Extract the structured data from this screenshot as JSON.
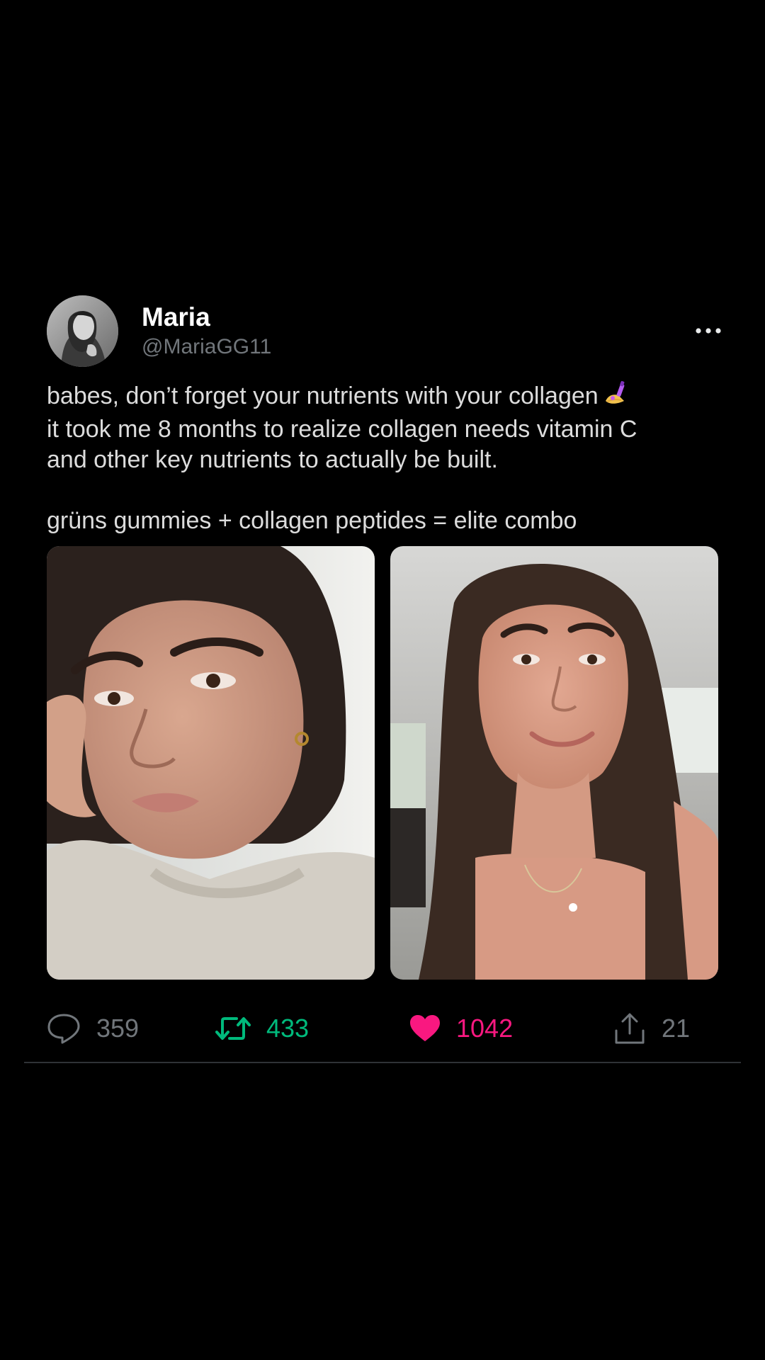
{
  "author": {
    "display_name": "Maria",
    "handle": "@MariaGG11"
  },
  "tweet": {
    "lines": [
      "babes, don’t forget your nutrients with your collagen",
      "it took me 8 months to realize collagen needs vitamin C",
      "and other key nutrients to actually be built.",
      "grüns gummies + collagen peptides = elite combo"
    ],
    "emoji": "nail-polish-emoji"
  },
  "media": [
    {
      "label": "before photo",
      "icon": "photo-image"
    },
    {
      "label": "after photo",
      "icon": "photo-image"
    }
  ],
  "actions": {
    "reply": {
      "count": "359",
      "icon": "reply-icon",
      "color": "#71767b"
    },
    "retweet": {
      "count": "433",
      "icon": "retweet-icon",
      "color": "#00ba7c"
    },
    "like": {
      "count": "1042",
      "icon": "heart-icon",
      "color": "#f91880"
    },
    "share": {
      "count": "21",
      "icon": "share-icon",
      "color": "#71767b"
    }
  },
  "colors": {
    "background": "#000000",
    "name": "#ffffff",
    "handle": "#71767b",
    "body_text": "#dcdcdc"
  }
}
